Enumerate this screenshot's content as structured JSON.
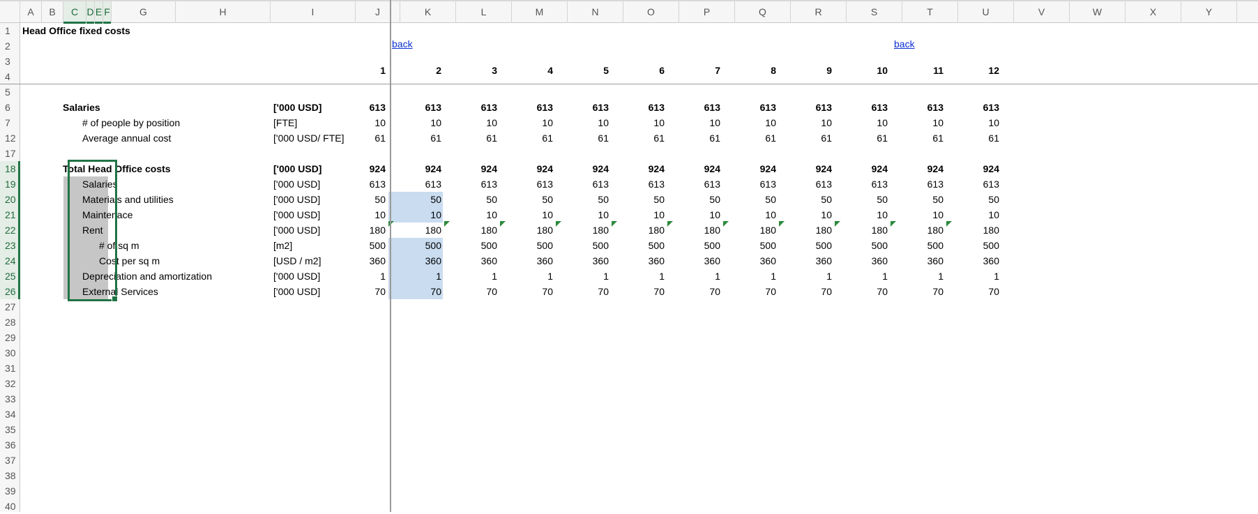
{
  "columns": [
    "A",
    "B",
    "C",
    "D",
    "E",
    "F",
    "G",
    "H",
    "I",
    "J",
    "K",
    "L",
    "M",
    "N",
    "O",
    "P",
    "Q",
    "R",
    "S",
    "T",
    "U",
    "V",
    "W",
    "X",
    "Y"
  ],
  "row_numbers": [
    "1",
    "2",
    "3",
    "4",
    "5",
    "6",
    "7",
    "12",
    "17",
    "18",
    "19",
    "20",
    "21",
    "22",
    "23",
    "24",
    "25",
    "26",
    "27",
    "28",
    "29",
    "30",
    "31",
    "32",
    "33",
    "34",
    "35",
    "36",
    "37",
    "38",
    "39",
    "40"
  ],
  "sheet": {
    "title": "Head Office fixed costs",
    "back_link_1": "back",
    "back_link_2": "back",
    "periods": [
      "1",
      "2",
      "3",
      "4",
      "5",
      "6",
      "7",
      "8",
      "9",
      "10",
      "11",
      "12"
    ]
  },
  "rows": [
    {
      "label": "Salaries",
      "unit": "['000 USD]",
      "values": [
        "613",
        "613",
        "613",
        "613",
        "613",
        "613",
        "613",
        "613",
        "613",
        "613",
        "613",
        "613"
      ]
    },
    {
      "label": "# of people by position",
      "unit": "[FTE]",
      "values": [
        "10",
        "10",
        "10",
        "10",
        "10",
        "10",
        "10",
        "10",
        "10",
        "10",
        "10",
        "10"
      ]
    },
    {
      "label": "Average annual cost",
      "unit": "['000 USD/ FTE]",
      "values": [
        "61",
        "61",
        "61",
        "61",
        "61",
        "61",
        "61",
        "61",
        "61",
        "61",
        "61",
        "61"
      ]
    },
    {
      "label": "Total Head Office costs",
      "unit": "['000 USD]",
      "values": [
        "924",
        "924",
        "924",
        "924",
        "924",
        "924",
        "924",
        "924",
        "924",
        "924",
        "924",
        "924"
      ]
    },
    {
      "label": "Salaries",
      "unit": "['000 USD]",
      "values": [
        "613",
        "613",
        "613",
        "613",
        "613",
        "613",
        "613",
        "613",
        "613",
        "613",
        "613",
        "613"
      ]
    },
    {
      "label": "Materials and utilities",
      "unit": "['000 USD]",
      "values": [
        "50",
        "50",
        "50",
        "50",
        "50",
        "50",
        "50",
        "50",
        "50",
        "50",
        "50",
        "50"
      ]
    },
    {
      "label": "Maintenace",
      "unit": "['000 USD]",
      "values": [
        "10",
        "10",
        "10",
        "10",
        "10",
        "10",
        "10",
        "10",
        "10",
        "10",
        "10",
        "10"
      ]
    },
    {
      "label": "Rent",
      "unit": "['000 USD]",
      "values": [
        "180",
        "180",
        "180",
        "180",
        "180",
        "180",
        "180",
        "180",
        "180",
        "180",
        "180",
        "180"
      ]
    },
    {
      "label": "# of sq m",
      "unit": "[m2]",
      "values": [
        "500",
        "500",
        "500",
        "500",
        "500",
        "500",
        "500",
        "500",
        "500",
        "500",
        "500",
        "500"
      ]
    },
    {
      "label": "Cost per sq m",
      "unit": "[USD / m2]",
      "values": [
        "360",
        "360",
        "360",
        "360",
        "360",
        "360",
        "360",
        "360",
        "360",
        "360",
        "360",
        "360"
      ]
    },
    {
      "label": "Depreciation and amortization",
      "unit": "['000 USD]",
      "values": [
        "1",
        "1",
        "1",
        "1",
        "1",
        "1",
        "1",
        "1",
        "1",
        "1",
        "1",
        "1"
      ]
    },
    {
      "label": "External Services",
      "unit": "['000 USD]",
      "values": [
        "70",
        "70",
        "70",
        "70",
        "70",
        "70",
        "70",
        "70",
        "70",
        "70",
        "70",
        "70"
      ]
    }
  ],
  "selected_columns": [
    "C",
    "D",
    "E",
    "F"
  ],
  "selected_rows": [
    "18",
    "19",
    "20",
    "21",
    "22",
    "23",
    "24",
    "25",
    "26"
  ],
  "colors": {
    "selection": "#217346",
    "input_fill": "#c9dcf0",
    "gray_fill": "#c6c6c6",
    "link": "#0b2fd1"
  }
}
